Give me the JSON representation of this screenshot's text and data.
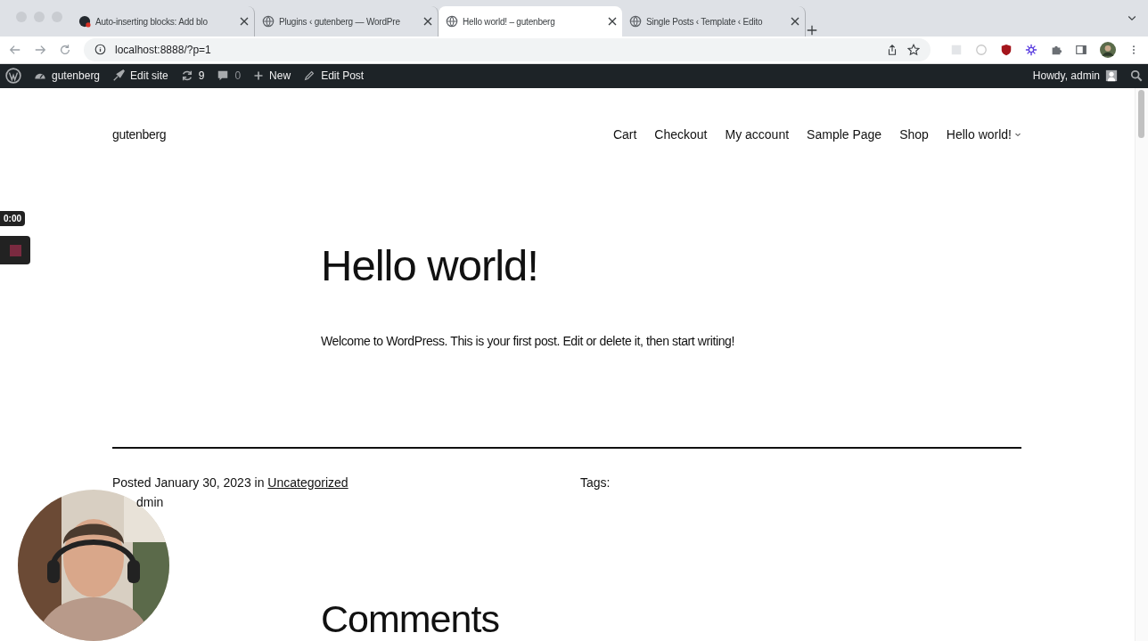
{
  "browser": {
    "tabs": [
      {
        "title": "Auto-inserting blocks: Add blo",
        "kind": "github",
        "selected": false
      },
      {
        "title": "Plugins ‹ gutenberg — WordPre",
        "kind": "globe",
        "selected": false
      },
      {
        "title": "Hello world! – gutenberg",
        "kind": "globe",
        "selected": true
      },
      {
        "title": "Single Posts ‹ Template ‹ Edito",
        "kind": "globe",
        "selected": false
      }
    ],
    "address": "localhost:8888/?p=1"
  },
  "admin_bar": {
    "site": "gutenberg",
    "edit_site": "Edit site",
    "updates": "9",
    "comments": "0",
    "new": "New",
    "edit_post": "Edit Post",
    "howdy": "Howdy, admin"
  },
  "site": {
    "title": "gutenberg",
    "nav": [
      {
        "label": "Cart",
        "submenu": false
      },
      {
        "label": "Checkout",
        "submenu": false
      },
      {
        "label": "My account",
        "submenu": false
      },
      {
        "label": "Sample Page",
        "submenu": false
      },
      {
        "label": "Shop",
        "submenu": false
      },
      {
        "label": "Hello world!",
        "submenu": true
      }
    ]
  },
  "post": {
    "title": "Hello world!",
    "body": "Welcome to WordPress. This is your first post. Edit or delete it, then start writing!",
    "posted": "Posted January 30, 2023 in",
    "category": "Uncategorized",
    "tags_label": "Tags:",
    "author_fragment": "dmin"
  },
  "comments_heading": "Comments",
  "recorder": {
    "time": "0:00"
  }
}
